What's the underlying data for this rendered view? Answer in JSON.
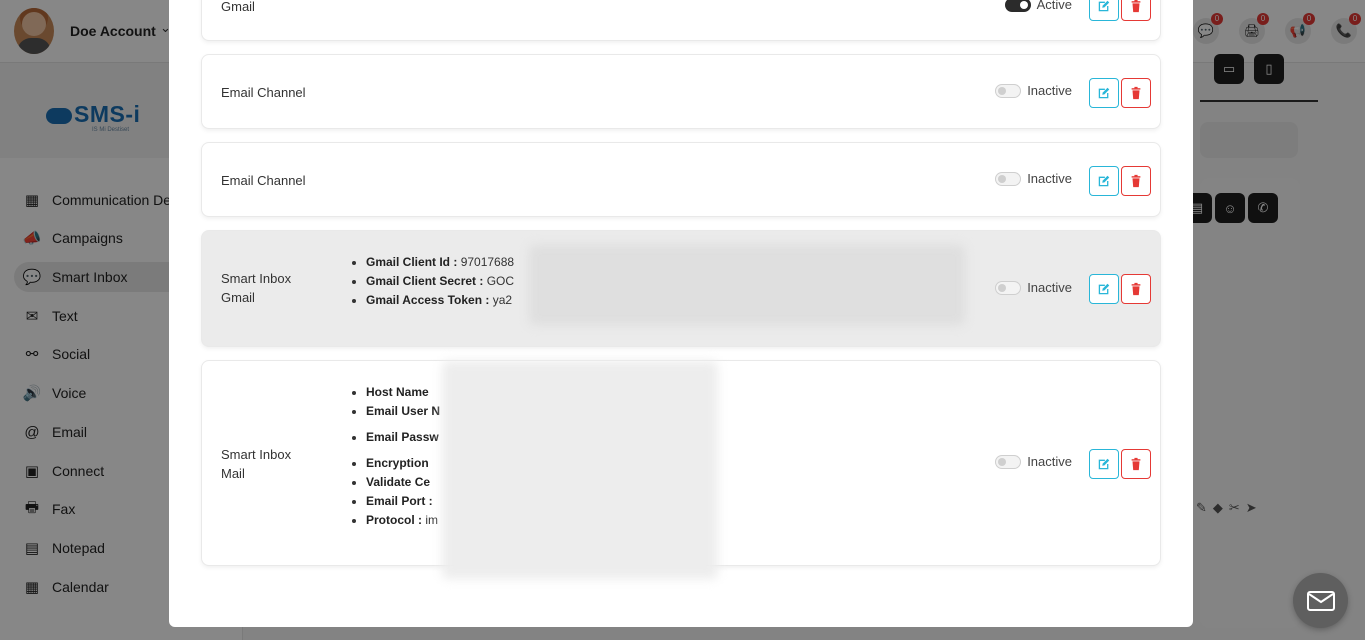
{
  "header": {
    "account_name": "Doe Account",
    "account_chevron": "⌄",
    "icons": [
      {
        "name": "chat-icon",
        "glyph": "💬",
        "badge": "0"
      },
      {
        "name": "print-icon",
        "glyph": "🖨",
        "badge": "0"
      },
      {
        "name": "megaphone-icon",
        "glyph": "📢",
        "badge": "0"
      },
      {
        "name": "phone-icon",
        "glyph": "📞",
        "badge": "0"
      }
    ]
  },
  "logo": {
    "text": "SMS-i",
    "tagline": "IS Mi Destiset"
  },
  "sidebar": {
    "items": [
      {
        "label": "Communication De",
        "icon": "grid-icon",
        "glyph": "▦"
      },
      {
        "label": "Campaigns",
        "icon": "megaphone-icon",
        "glyph": "📣"
      },
      {
        "label": "Smart Inbox",
        "icon": "chat-bubble-icon",
        "glyph": "💬",
        "active": true
      },
      {
        "label": "Text",
        "icon": "envelope-icon",
        "glyph": "✉"
      },
      {
        "label": "Social",
        "icon": "share-icon",
        "glyph": "⚯"
      },
      {
        "label": "Voice",
        "icon": "voice-icon",
        "glyph": "🔊"
      },
      {
        "label": "Email",
        "icon": "at-icon",
        "glyph": "@"
      },
      {
        "label": "Connect",
        "icon": "connect-icon",
        "glyph": "▣"
      },
      {
        "label": "Fax",
        "icon": "printer-icon",
        "glyph": "🖶"
      },
      {
        "label": "Notepad",
        "icon": "notepad-icon",
        "glyph": "▤"
      },
      {
        "label": "Calendar",
        "icon": "calendar-icon",
        "glyph": "▦"
      }
    ]
  },
  "modal": {
    "channels": [
      {
        "name_line1": "Gmail",
        "name_line2": "",
        "status": "Active",
        "toggle_on": true,
        "details": []
      },
      {
        "name_line1": "Email Channel",
        "name_line2": "",
        "status": "Inactive",
        "toggle_on": false,
        "details": []
      },
      {
        "name_line1": "Email Channel",
        "name_line2": "",
        "status": "Inactive",
        "toggle_on": false,
        "details": []
      },
      {
        "name_line1": "Smart Inbox",
        "name_line2": "Gmail",
        "status": "Inactive",
        "toggle_on": false,
        "details": [
          {
            "label": "Gmail Client Id :",
            "value": "97017688"
          },
          {
            "label": "Gmail Client Secret :",
            "value": "GOC"
          },
          {
            "label": "Gmail Access Token :",
            "value": "ya2"
          }
        ]
      },
      {
        "name_line1": "Smart Inbox",
        "name_line2": "Mail",
        "status": "Inactive",
        "toggle_on": false,
        "details": [
          {
            "label": "Host Name",
            "value": ""
          },
          {
            "label": "Email User N",
            "value": ""
          },
          {
            "label": "Email Passw",
            "value": ""
          },
          {
            "label": "Encryption",
            "value": ""
          },
          {
            "label": "Validate Ce",
            "value": ""
          },
          {
            "label": "Email Port :",
            "value": ""
          },
          {
            "label": "Protocol :",
            "value": "im"
          }
        ]
      }
    ]
  },
  "colors": {
    "edit": "#29b6d8",
    "delete": "#e53935",
    "overlay": "rgba(0,0,0,0.47)"
  }
}
